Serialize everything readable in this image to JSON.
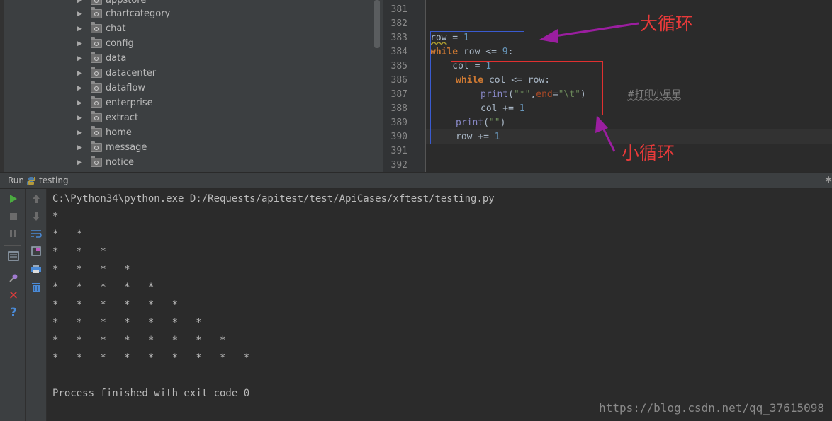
{
  "project_tree": {
    "items": [
      {
        "label": "appstore"
      },
      {
        "label": "chartcategory"
      },
      {
        "label": "chat"
      },
      {
        "label": "config"
      },
      {
        "label": "data"
      },
      {
        "label": "datacenter"
      },
      {
        "label": "dataflow"
      },
      {
        "label": "enterprise"
      },
      {
        "label": "extract"
      },
      {
        "label": "home"
      },
      {
        "label": "message"
      },
      {
        "label": "notice"
      }
    ]
  },
  "editor": {
    "line_numbers": [
      "381",
      "382",
      "383",
      "384",
      "385",
      "386",
      "387",
      "388",
      "389",
      "390",
      "391",
      "392"
    ],
    "code": {
      "l383_var": "row",
      "l383_op": " = ",
      "l383_num": "1",
      "l384_kw": "while",
      "l384_rest": " row <= ",
      "l384_num": "9",
      "l384_colon": ":",
      "l385_text": "    col = ",
      "l385_num": "1",
      "l386_kw": "while",
      "l386_rest": " col <= row:",
      "l387_fn": "print",
      "l387_open": "(",
      "l387_str1": "\"*\"",
      "l387_comma": ",",
      "l387_kwarg": "end",
      "l387_eq": "=",
      "l387_str2": "\"\\t\"",
      "l387_close": ")",
      "l387_comment": "#打印小星星",
      "l388_text": "col += ",
      "l388_num": "1",
      "l389_fn": "print",
      "l389_open": "(",
      "l389_str": "\"\"",
      "l389_close": ")",
      "l390_text": "row += ",
      "l390_num": "1"
    },
    "annotations": {
      "outer_loop": "大循环",
      "inner_loop": "小循环"
    },
    "annotation_color": "#e83a3a",
    "arrow_color": "#9b1ea0"
  },
  "run_panel": {
    "title": "Run",
    "config_name": "testing",
    "toolbar_icons": [
      "run-icon",
      "stop-icon",
      "pause-icon",
      "dump-threads-icon",
      "pin-icon",
      "close-icon",
      "help-icon",
      "up-arrow-icon",
      "down-arrow-icon",
      "soft-wrap-icon",
      "scroll-to-end-icon",
      "print-icon",
      "clear-all-icon"
    ]
  },
  "console": {
    "lines": [
      "C:\\Python34\\python.exe D:/Requests/apitest/test/ApiCases/xftest/testing.py",
      "*",
      "*   *",
      "*   *   *",
      "*   *   *   *",
      "*   *   *   *   *",
      "*   *   *   *   *   *",
      "*   *   *   *   *   *   *",
      "*   *   *   *   *   *   *   *",
      "*   *   *   *   *   *   *   *   *",
      "",
      "Process finished with exit code 0"
    ]
  },
  "watermark": "https://blog.csdn.net/qq_37615098"
}
